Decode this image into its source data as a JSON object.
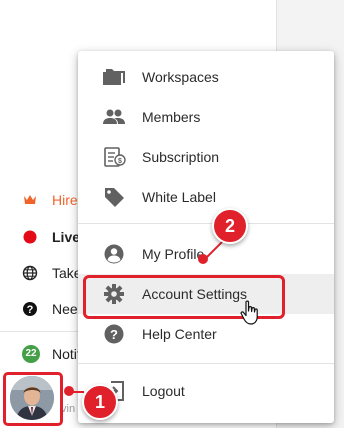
{
  "sidebar": {
    "items": [
      {
        "label": "Hire",
        "icon": "crown-icon",
        "color": "#f0642c"
      },
      {
        "label": "Live",
        "icon": "live-dot-icon",
        "color": "#e30b17"
      },
      {
        "label": "Take",
        "icon": "globe-icon",
        "color": "#222222"
      },
      {
        "label": "Need",
        "icon": "help-icon",
        "color": "#222222"
      }
    ],
    "notifications": {
      "badge": "22",
      "label": "Notifi"
    },
    "user_name_fragment": "vin"
  },
  "menu": {
    "items": [
      {
        "label": "Workspaces",
        "icon": "folder-icon"
      },
      {
        "label": "Members",
        "icon": "members-icon"
      },
      {
        "label": "Subscription",
        "icon": "invoice-icon"
      },
      {
        "label": "White Label",
        "icon": "tag-icon"
      },
      {
        "label": "My Profile",
        "icon": "profile-icon"
      },
      {
        "label": "Account Settings",
        "icon": "gear-icon",
        "highlighted": true
      },
      {
        "label": "Help Center",
        "icon": "help-icon"
      },
      {
        "label": "Logout",
        "icon": "logout-icon"
      }
    ]
  },
  "callouts": [
    {
      "number": "1"
    },
    {
      "number": "2"
    }
  ],
  "colors": {
    "accent_red": "#e0202a",
    "hire_orange": "#f0642c",
    "badge_green": "#43a047",
    "icon_gray": "#616161"
  }
}
